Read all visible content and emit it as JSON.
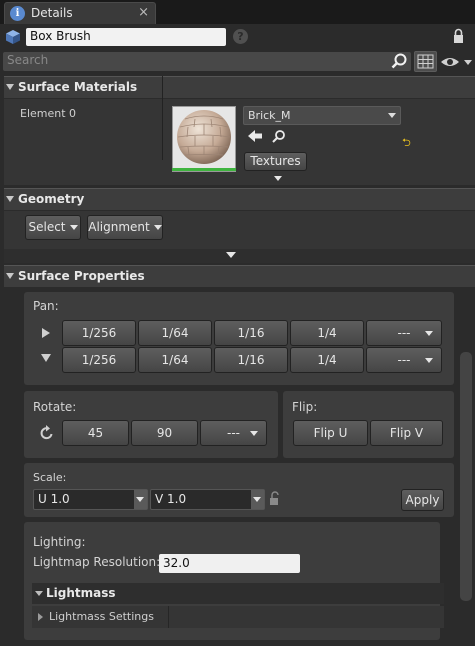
{
  "tab": {
    "title": "Details",
    "close_glyph": "×",
    "info_glyph": "i"
  },
  "actor": {
    "name": "Box Brush",
    "help_glyph": "?"
  },
  "search": {
    "placeholder": "Search"
  },
  "surface_materials": {
    "title": "Surface Materials",
    "element_label": "Element 0",
    "material_name": "Brick_M",
    "textures_label": "Textures",
    "reset_glyph": "⮌"
  },
  "geometry": {
    "title": "Geometry",
    "select_label": "Select",
    "alignment_label": "Alignment"
  },
  "surface_properties": {
    "title": "Surface Properties",
    "pan": {
      "label": "Pan:",
      "row1": [
        "1/256",
        "1/64",
        "1/16",
        "1/4",
        "---"
      ],
      "row2": [
        "1/256",
        "1/64",
        "1/16",
        "1/4",
        "---"
      ]
    },
    "rotate": {
      "label": "Rotate:",
      "values": [
        "45",
        "90",
        "---"
      ]
    },
    "flip": {
      "label": "Flip:",
      "u": "Flip U",
      "v": "Flip V"
    },
    "scale": {
      "label": "Scale:",
      "u": "U  1.0",
      "v": "V  1.0",
      "apply": "Apply"
    },
    "lighting": {
      "label": "Lighting:",
      "lightmap_label": "Lightmap Resolution:",
      "lightmap_value": "32.0",
      "lightmass_title": "Lightmass",
      "lightmass_settings": "Lightmass Settings"
    }
  },
  "colors": {
    "material_green": "#3fb43f",
    "reset_yellow": "#e8c020",
    "info_blue": "#5a8ad0"
  }
}
